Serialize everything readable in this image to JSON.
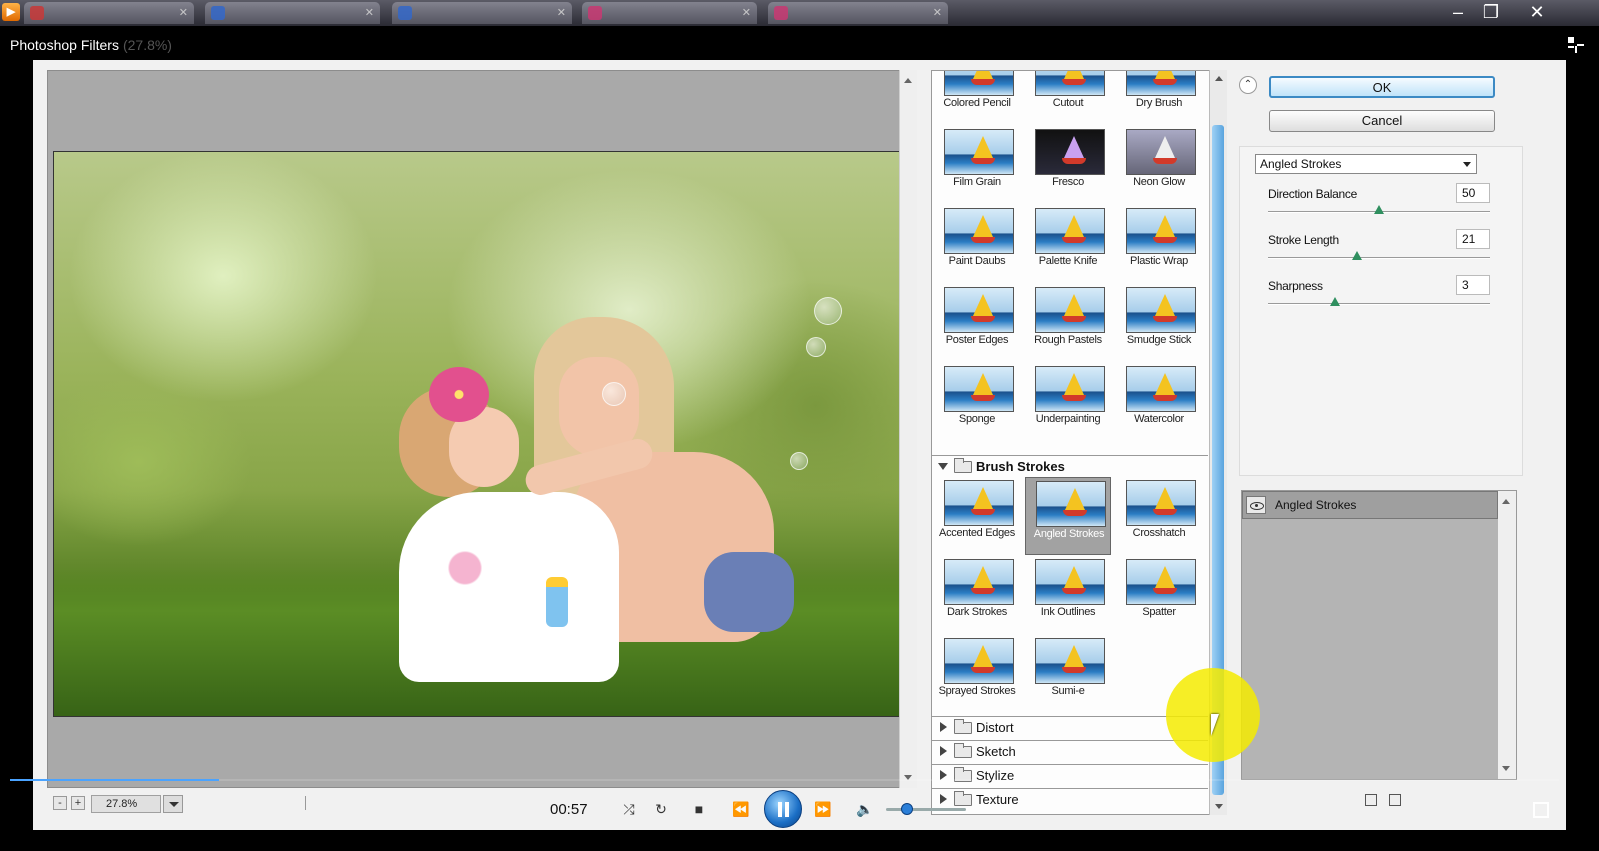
{
  "browser": {
    "tabs_count_hint": "5 tabs"
  },
  "window": {
    "title": "Photoshop Filters",
    "title_zoom": "(27.8%)",
    "minimize": "‒",
    "maximize": "❐",
    "close": "✕"
  },
  "preview": {
    "zoom": "27.8%",
    "zoom_minus": "-",
    "zoom_plus": "+"
  },
  "gallery": {
    "artistic_items": [
      "Colored Pencil",
      "Cutout",
      "Dry Brush",
      "Film Grain",
      "Fresco",
      "Neon Glow",
      "Paint Daubs",
      "Palette Knife",
      "Plastic Wrap",
      "Poster Edges",
      "Rough Pastels",
      "Smudge Stick",
      "Sponge",
      "Underpainting",
      "Watercolor"
    ],
    "brush_strokes": {
      "label": "Brush Strokes",
      "items": [
        "Accented Edges",
        "Angled Strokes",
        "Crosshatch",
        "Dark Strokes",
        "Ink Outlines",
        "Spatter",
        "Sprayed Strokes",
        "Sumi-e"
      ],
      "selected": "Angled Strokes"
    },
    "collapsed_categories": [
      "Distort",
      "Sketch",
      "Stylize",
      "Texture"
    ]
  },
  "settings": {
    "collapse_glyph": "⌃",
    "ok_label": "OK",
    "cancel_label": "Cancel",
    "filter_select": "Angled Strokes",
    "params": [
      {
        "label": "Direction Balance",
        "value": "50",
        "level": 0.5
      },
      {
        "label": "Stroke Length",
        "value": "21",
        "level": 0.4
      },
      {
        "label": "Sharpness",
        "value": "3",
        "level": 0.3
      }
    ]
  },
  "layers": {
    "active_layer": "Angled Strokes"
  },
  "player": {
    "timecode": "00:57",
    "progress": 0.135,
    "volume": 0.2,
    "rewind": "⏪",
    "forward": "⏩",
    "stop": "■"
  },
  "colors": {
    "ok_border": "#3c8ac4",
    "progress": "#4aa3ff",
    "cursor_highlight": "#f5eb00"
  }
}
